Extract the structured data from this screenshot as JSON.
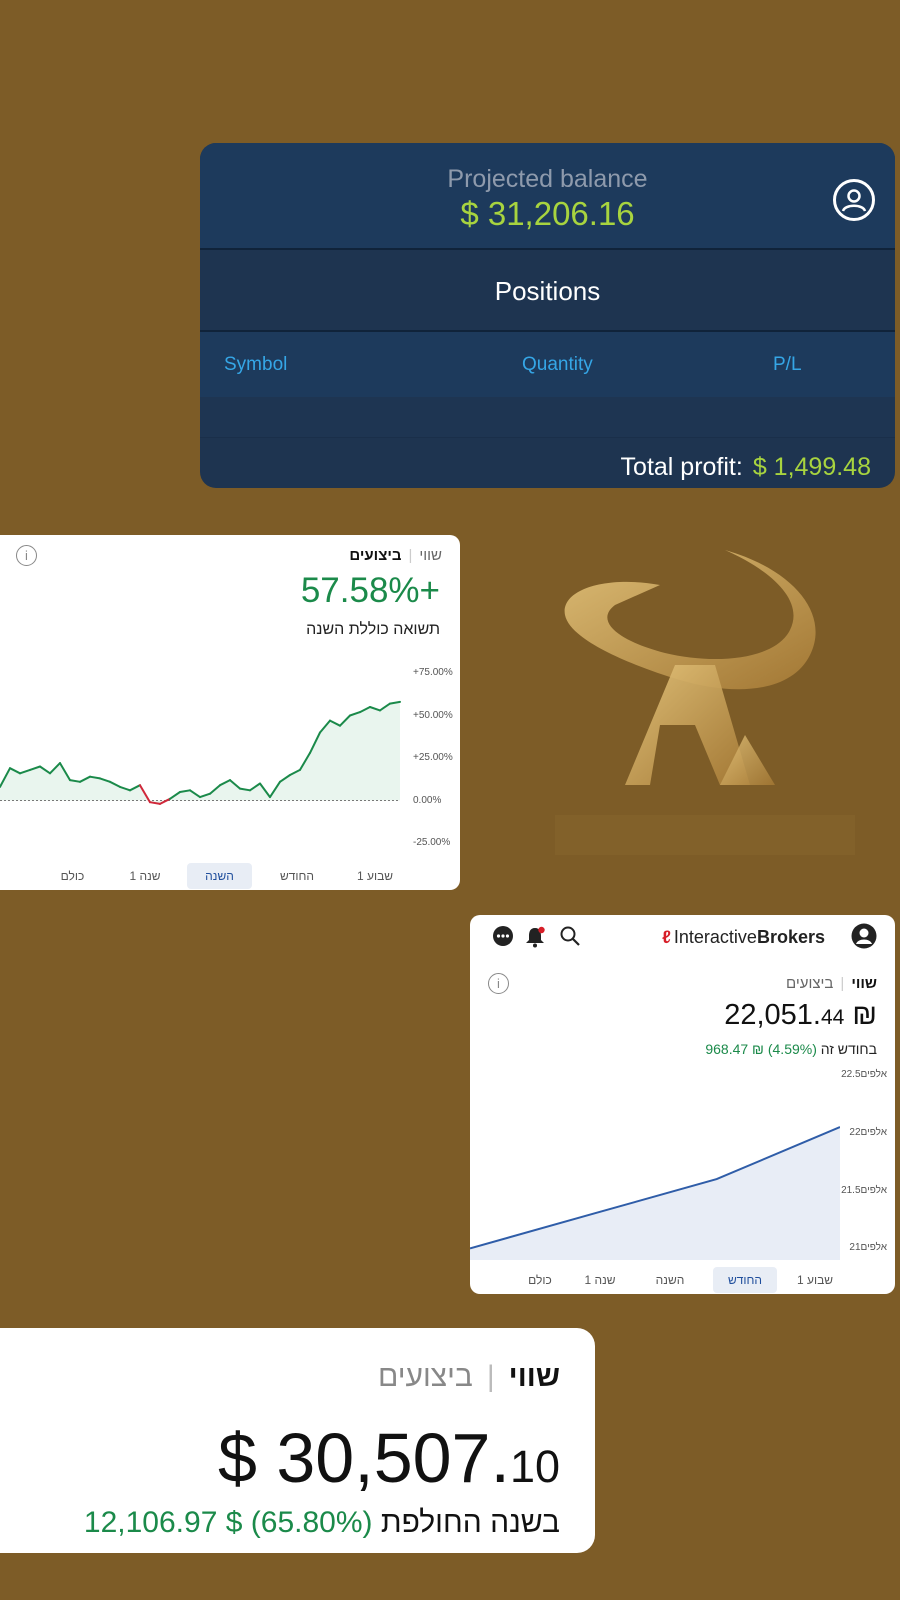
{
  "balance_card": {
    "projected_label": "Projected balance",
    "projected_value": "$ 31,206.16",
    "positions_title": "Positions",
    "columns": [
      "Symbol",
      "Quantity",
      "P/L"
    ],
    "total_label": "Total profit:",
    "total_value": "$ 1,499.48"
  },
  "performance_card": {
    "tab_selected": "ביצועים",
    "tab_other": "שווי",
    "percent": "57.58%+",
    "subtitle": "תשואה כוללת השנה",
    "y_ticks": [
      "+75.00%",
      "+50.00%",
      "+25.00%",
      "0.00%",
      "-25.00%"
    ],
    "periods": [
      "שבוע 1",
      "החודש",
      "השנה",
      "שנה 1",
      "כולם"
    ],
    "active_period": "השנה",
    "info_icon": "i"
  },
  "ib_card": {
    "brand_mark": "ℓ",
    "brand_regular": "Interactive",
    "brand_bold": "Brokers",
    "tab_selected": "שווי",
    "tab_other": "ביצועים",
    "info_icon": "i",
    "value_main": "₪ 22,051.",
    "value_decimal": "44",
    "change_amount": "₪ 968.47",
    "change_percent": "(4.59%)",
    "change_label": "בחודש זה",
    "y_ticks": [
      "22.5אלפים",
      "22אלפים",
      "21.5אלפים",
      "21אלפים"
    ],
    "periods": [
      "שבוע 1",
      "החודש",
      "השנה",
      "שנה 1",
      "כולם"
    ],
    "active_period": "החודש"
  },
  "value_card": {
    "tab_selected": "שווי",
    "tab_other": "ביצועים",
    "value_main": "$ 30,507.",
    "value_decimal": "10",
    "change_amount": "$ 12,106.97",
    "change_percent": "(65.80%)",
    "change_label": "בשנה החולפת"
  },
  "chart_data": [
    {
      "type": "area",
      "title": "",
      "x": [
        0,
        1,
        2,
        3,
        4,
        5,
        6,
        7,
        8,
        9,
        10,
        11,
        12,
        13,
        14,
        15,
        16,
        17,
        18,
        19,
        20,
        21,
        22,
        23,
        24,
        25,
        26,
        27,
        28,
        29,
        30,
        31,
        32,
        33,
        34,
        35,
        36,
        37,
        38,
        39,
        40
      ],
      "values": [
        8,
        19,
        16,
        18,
        20,
        16,
        22,
        12,
        11,
        14,
        13,
        11,
        8,
        6,
        9,
        -1,
        -2,
        1,
        5,
        6,
        2,
        4,
        9,
        12,
        7,
        6,
        10,
        2,
        11,
        15,
        18,
        28,
        40,
        47,
        44,
        50,
        52,
        55,
        53,
        57,
        58
      ],
      "ylim": [
        -25,
        75
      ],
      "y_ticks": [
        "+75.00%",
        "+50.00%",
        "+25.00%",
        "0.00%",
        "-25.00%"
      ],
      "baseline": 0,
      "colors": {
        "up": "#1b8a4a",
        "down": "#d0283a",
        "fill": "#e4f3ea"
      }
    },
    {
      "type": "area",
      "title": "",
      "x": [
        0,
        1,
        2,
        3
      ],
      "values": [
        21.0,
        21.3,
        21.6,
        22.05
      ],
      "ylim": [
        20.9,
        22.5
      ],
      "y_ticks": [
        "22.5אלפים",
        "22אלפים",
        "21.5אלפים",
        "21אלפים"
      ],
      "colors": {
        "line": "#2f5da8",
        "fill": "#e8edf6"
      }
    }
  ]
}
